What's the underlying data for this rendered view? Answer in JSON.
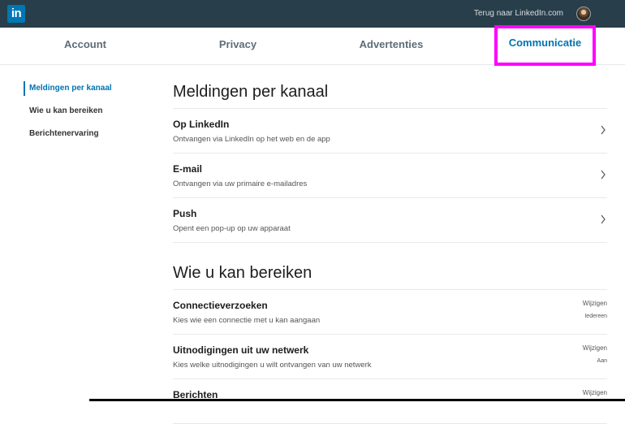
{
  "topbar": {
    "logo_text": "in",
    "back_link": "Terug naar LinkedIn.com",
    "avatar_icon": "user-avatar"
  },
  "tabs": [
    {
      "label": "Account"
    },
    {
      "label": "Privacy"
    },
    {
      "label": "Advertenties"
    },
    {
      "label": "Communicatie",
      "active": true
    }
  ],
  "sidebar": {
    "items": [
      {
        "label": "Meldingen per kanaal",
        "active": true
      },
      {
        "label": "Wie u kan bereiken"
      },
      {
        "label": "Berichtenervaring"
      }
    ]
  },
  "sections": [
    {
      "title": "Meldingen per kanaal",
      "rows": [
        {
          "title": "Op LinkedIn",
          "subtitle": "Ontvangen via LinkedIn op het web en de app",
          "icon": "chevron-right-icon"
        },
        {
          "title": "E-mail",
          "subtitle": "Ontvangen via uw primaire e-mailadres",
          "icon": "chevron-right-icon"
        },
        {
          "title": "Push",
          "subtitle": "Opent een pop-up op uw apparaat",
          "icon": "chevron-right-icon"
        }
      ]
    },
    {
      "title": "Wie u kan bereiken",
      "rows": [
        {
          "title": "Connectieverzoeken",
          "subtitle": "Kies wie een connectie met u kan aangaan",
          "action": "Wijzigen",
          "value": "Iedereen"
        },
        {
          "title": "Uitnodigingen uit uw netwerk",
          "subtitle": "Kies welke uitnodigingen u wilt ontvangen van uw netwerk",
          "action": "Wijzigen",
          "value": "Aan"
        },
        {
          "title": "Berichten",
          "subtitle": "",
          "action": "Wijzigen",
          "value": ""
        }
      ]
    }
  ],
  "colors": {
    "topbar": "#283e4a",
    "accent": "#0073b1",
    "highlight": "#ff00ff"
  }
}
